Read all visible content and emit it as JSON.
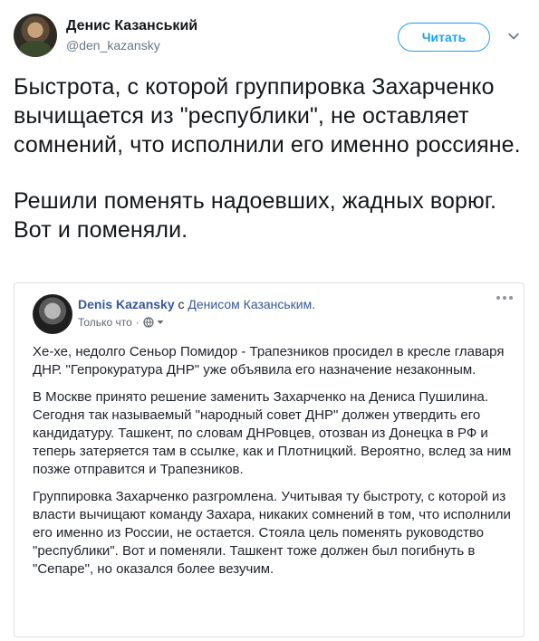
{
  "author": {
    "display_name": "Денис Казанський",
    "handle": "@den_kazansky"
  },
  "follow_button": {
    "label": "Читать"
  },
  "tweet": {
    "paragraphs": [
      "Быстрота, с которой группировка Захарченко вычищается из \"республики\", не оставляет сомнений, что исполнили его именно россияне.",
      "Решили поменять надоевших, жадных ворюг. Вот и поменяли."
    ]
  },
  "embedded_post": {
    "author": "Denis Kazansky",
    "with_text": " с ",
    "tagged": "Денисом Казанським.",
    "meta": "Только что",
    "meta_sep": "·",
    "paragraphs": [
      "Хе-хе, недолго Сеньор Помидор - Трапезников просидел в кресле главаря ДНР. \"Гепрокуратура ДНР\" уже объявила его назначение незаконным.",
      "В Москве принято решение заменить Захарченко на Дениса Пушилина. Сегодня так называемый \"народный совет ДНР\" должен утвердить его кандидатуру. Ташкент, по словам ДНРовцев, отозван из Донецка в РФ и теперь затеряется там в ссылке, как и Плотницкий. Вероятно, вслед за ним позже отправится и Трапезников.",
      "Группировка Захарченко разгромлена. Учитывая ту быстроту, с которой из власти вычищают команду Захара, никаких сомнений в том, что исполнили его именно из России, не остается. Стояла цель поменять руководство \"республики\". Вот и поменяли. Ташкент тоже должен был погибнуть в \"Сепаре\", но оказался более везучим."
    ]
  },
  "colors": {
    "accent": "#1da1f2",
    "fb_link": "#365899",
    "text": "#14171a",
    "muted": "#657786"
  },
  "icons": {
    "caret": "chevron-down-icon",
    "globe": "globe-icon",
    "more": "more-options-icon"
  }
}
